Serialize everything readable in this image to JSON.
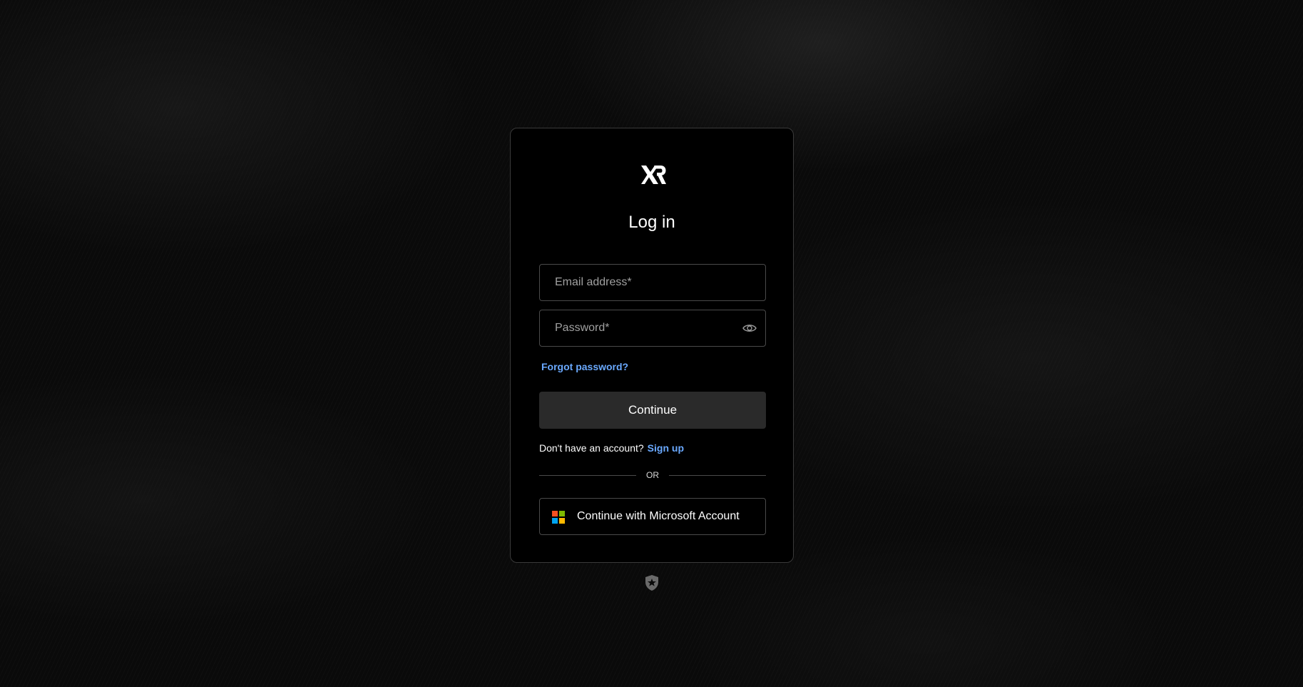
{
  "page": {
    "title": "Log in"
  },
  "form": {
    "email_placeholder": "Email address*",
    "email_value": "",
    "password_placeholder": "Password*",
    "password_value": "",
    "forgot_password": "Forgot password?",
    "continue_label": "Continue"
  },
  "signup": {
    "prompt": "Don't have an account?",
    "link": "Sign up"
  },
  "divider": {
    "text": "OR"
  },
  "social": {
    "microsoft_label": "Continue with Microsoft Account"
  },
  "icons": {
    "brand_logo": "xr-logo-icon",
    "password_toggle": "eye-icon",
    "microsoft": "microsoft-logo-icon",
    "footer_badge": "shield-icon"
  },
  "colors": {
    "link": "#6aa9ff",
    "button": "#2a2a2a",
    "card": "#000000",
    "ms_red": "#f25022",
    "ms_green": "#7fba00",
    "ms_blue": "#00a4ef",
    "ms_yellow": "#ffb900"
  }
}
